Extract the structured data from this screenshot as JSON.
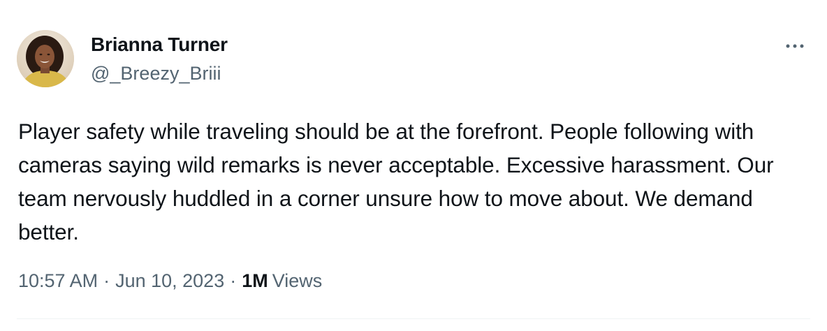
{
  "author": {
    "display_name": "Brianna Turner",
    "handle": "@_Breezy_Briii"
  },
  "tweet": {
    "text": "Player safety while traveling should be at the forefront. People following with cameras saying wild remarks is never acceptable. Excessive harassment. Our team nervously huddled in a corner unsure how to move about. We demand better."
  },
  "meta": {
    "time": "10:57 AM",
    "separator": "·",
    "date": "Jun 10, 2023",
    "views_count": "1M",
    "views_label": "Views"
  },
  "icons": {
    "more": "more-horizontal-icon"
  },
  "colors": {
    "primary_text": "#0f1419",
    "secondary_text": "#536471",
    "divider": "#eff3f4"
  }
}
